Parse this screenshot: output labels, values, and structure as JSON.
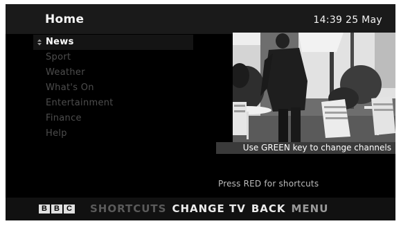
{
  "header": {
    "title": "Home",
    "clock": "14:39 25 May"
  },
  "menu": {
    "items": [
      {
        "label": "News",
        "selected": true
      },
      {
        "label": "Sport",
        "selected": false
      },
      {
        "label": "Weather",
        "selected": false
      },
      {
        "label": "What's On",
        "selected": false
      },
      {
        "label": "Entertainment",
        "selected": false
      },
      {
        "label": "Finance",
        "selected": false
      },
      {
        "label": "Help",
        "selected": false
      }
    ]
  },
  "video": {
    "caption": "Use GREEN key to change channels"
  },
  "hint": {
    "text": "Press RED for shortcuts"
  },
  "footer": {
    "logo_letters": [
      "B",
      "B",
      "C"
    ],
    "shortcuts_label": "SHORTCUTS",
    "change_tv_label": "CHANGE TV",
    "back_label": "BACK",
    "menu_label": "MENU"
  },
  "colors": {
    "background": "#000000",
    "header_bar": "#1a1a1a",
    "selected_text": "#ffffff",
    "unselected_text": "#4d4d4d",
    "caption_bar": "#3a3a3a"
  }
}
